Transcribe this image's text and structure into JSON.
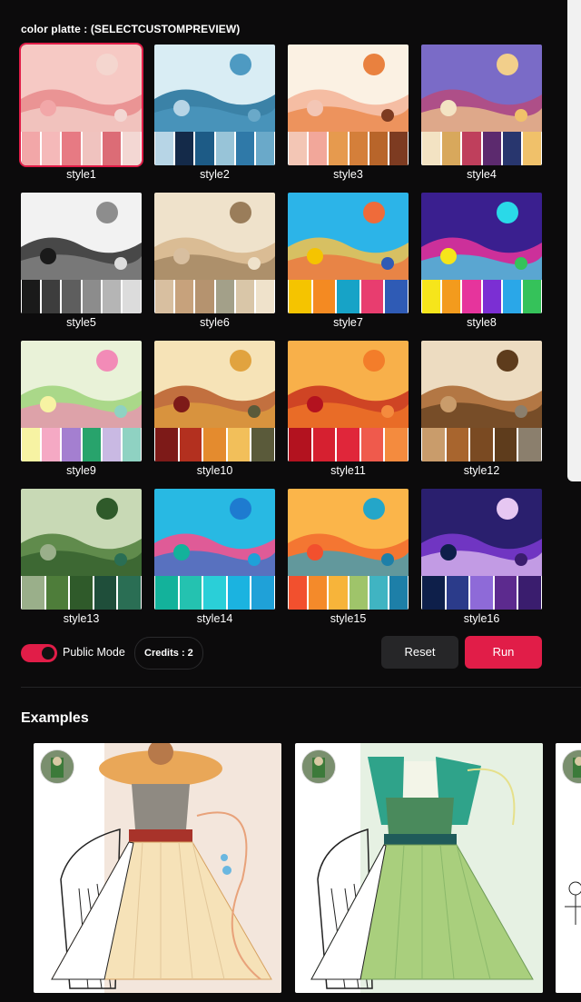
{
  "header": {
    "title": "color platte : (SELECTCUSTOMPREVIEW)"
  },
  "styles": [
    {
      "label": "style1",
      "sky": "#f6c9c4",
      "ground": "#e88b8c",
      "accent": "#f4d6cf",
      "swatches": [
        "#f2a7a8",
        "#f5b9b9",
        "#e77a83",
        "#f0c3bf",
        "#dc6c76",
        "#f3d7d3"
      ]
    },
    {
      "label": "style2",
      "sky": "#d9edf4",
      "ground": "#1f6f99",
      "accent": "#4e9ac2",
      "swatches": [
        "#b7d5e6",
        "#142a49",
        "#1d5b86",
        "#98c4d8",
        "#2f79a8",
        "#6aa9c9"
      ]
    },
    {
      "label": "style3",
      "sky": "#fbf1e3",
      "ground": "#f3b498",
      "accent": "#e9813f",
      "swatches": [
        "#f3c6b5",
        "#f2a79a",
        "#e69a4e",
        "#d47f3a",
        "#b8652a",
        "#7d3b21"
      ]
    },
    {
      "label": "style4",
      "sky": "#7a6bc7",
      "ground": "#b74a7d",
      "accent": "#f2cf8b",
      "swatches": [
        "#f3e3c3",
        "#d8a85c",
        "#bf3f5c",
        "#5c2a6e",
        "#28366e",
        "#f0c16a"
      ]
    },
    {
      "label": "style5",
      "sky": "#f2f2f2",
      "ground": "#2a2a2a",
      "accent": "#8d8d8d",
      "swatches": [
        "#1a1a1a",
        "#3d3d3d",
        "#5e5e5e",
        "#8c8c8c",
        "#b5b5b5",
        "#dcdcdc"
      ]
    },
    {
      "label": "style6",
      "sky": "#efe2cb",
      "ground": "#d6b58b",
      "accent": "#9a7d5a",
      "swatches": [
        "#d8bfa0",
        "#c7a27c",
        "#b5936f",
        "#a3a089",
        "#d9c6a8",
        "#efe2cb"
      ]
    },
    {
      "label": "style7",
      "sky": "#2cb4e8",
      "ground": "#f6c24a",
      "accent": "#ef6b3a",
      "swatches": [
        "#f5c400",
        "#f48a22",
        "#17a3c7",
        "#e83d6f",
        "#2f5bb5"
      ]
    },
    {
      "label": "style8",
      "sky": "#3a1f8f",
      "ground": "#e6349c",
      "accent": "#2ad9e8",
      "swatches": [
        "#f6e51b",
        "#f39b1d",
        "#e6349c",
        "#7b2fd3",
        "#2aa7e8",
        "#35c25a"
      ]
    },
    {
      "label": "style9",
      "sky": "#e9f2d8",
      "ground": "#9fd37b",
      "accent": "#f28bb7",
      "swatches": [
        "#f7f3a3",
        "#f5a9c4",
        "#a47fd0",
        "#28a36c",
        "#c9b9e3",
        "#8fd2c2"
      ]
    },
    {
      "label": "style10",
      "sky": "#f6e3b7",
      "ground": "#b85c2a",
      "accent": "#e1a33f",
      "swatches": [
        "#7d1a18",
        "#b3301f",
        "#e48b2e",
        "#f2bf5a",
        "#5a5a3a"
      ]
    },
    {
      "label": "style11",
      "sky": "#f8b04a",
      "ground": "#c8311d",
      "accent": "#f37d2a",
      "swatches": [
        "#b3121f",
        "#d62030",
        "#e0263a",
        "#ef5a4c",
        "#f48b3e"
      ]
    },
    {
      "label": "style12",
      "sky": "#eddcc1",
      "ground": "#a8652e",
      "accent": "#5e3c1c",
      "swatches": [
        "#c99c6b",
        "#a8652e",
        "#7a4a22",
        "#5e3c1c",
        "#8b7f6d"
      ]
    },
    {
      "label": "style13",
      "sky": "#c8d9b5",
      "ground": "#4e7d3a",
      "accent": "#2f5a2a",
      "swatches": [
        "#9aaf8a",
        "#4e7d3a",
        "#2f5a2a",
        "#1f4e3a",
        "#2a6e54"
      ]
    },
    {
      "label": "style14",
      "sky": "#28b9e3",
      "ground": "#ff4a8a",
      "accent": "#1e7bd0",
      "swatches": [
        "#13b29b",
        "#24c2b0",
        "#2acfd8",
        "#1bb3e0",
        "#1fa1d8"
      ]
    },
    {
      "label": "style15",
      "sky": "#fbb54a",
      "ground": "#f26b2e",
      "accent": "#24a6c9",
      "swatches": [
        "#f2502e",
        "#f48a2a",
        "#f7b43a",
        "#9fc46a",
        "#40b4c2",
        "#1d7fa8"
      ]
    },
    {
      "label": "style16",
      "sky": "#2a1f6e",
      "ground": "#7c3ad1",
      "accent": "#e6c7f2",
      "swatches": [
        "#0e1f4a",
        "#2b3b8a",
        "#8e6ad8",
        "#5c2a8e",
        "#3a1d6e"
      ]
    }
  ],
  "controls": {
    "public_mode_label": "Public Mode",
    "public_mode_on": true,
    "credits_label": "Credits : 2",
    "reset_label": "Reset",
    "run_label": "Run"
  },
  "examples": {
    "title": "Examples",
    "cards": [
      {
        "color_primary": "#f3dcc0",
        "color_dress": "#f6e2b8",
        "color_bodice": "#8f8a82",
        "color_belt": "#a8332a",
        "color_hat": "#e9a758"
      },
      {
        "color_primary": "#dfeee0",
        "color_dress": "#a9cf7d",
        "color_bodice": "#4a8a5c",
        "color_belt": "#1f5b5a",
        "color_hat": "#2fa38a"
      }
    ]
  },
  "colors": {
    "accent": "#e11d48",
    "background": "#0c0b0c"
  }
}
